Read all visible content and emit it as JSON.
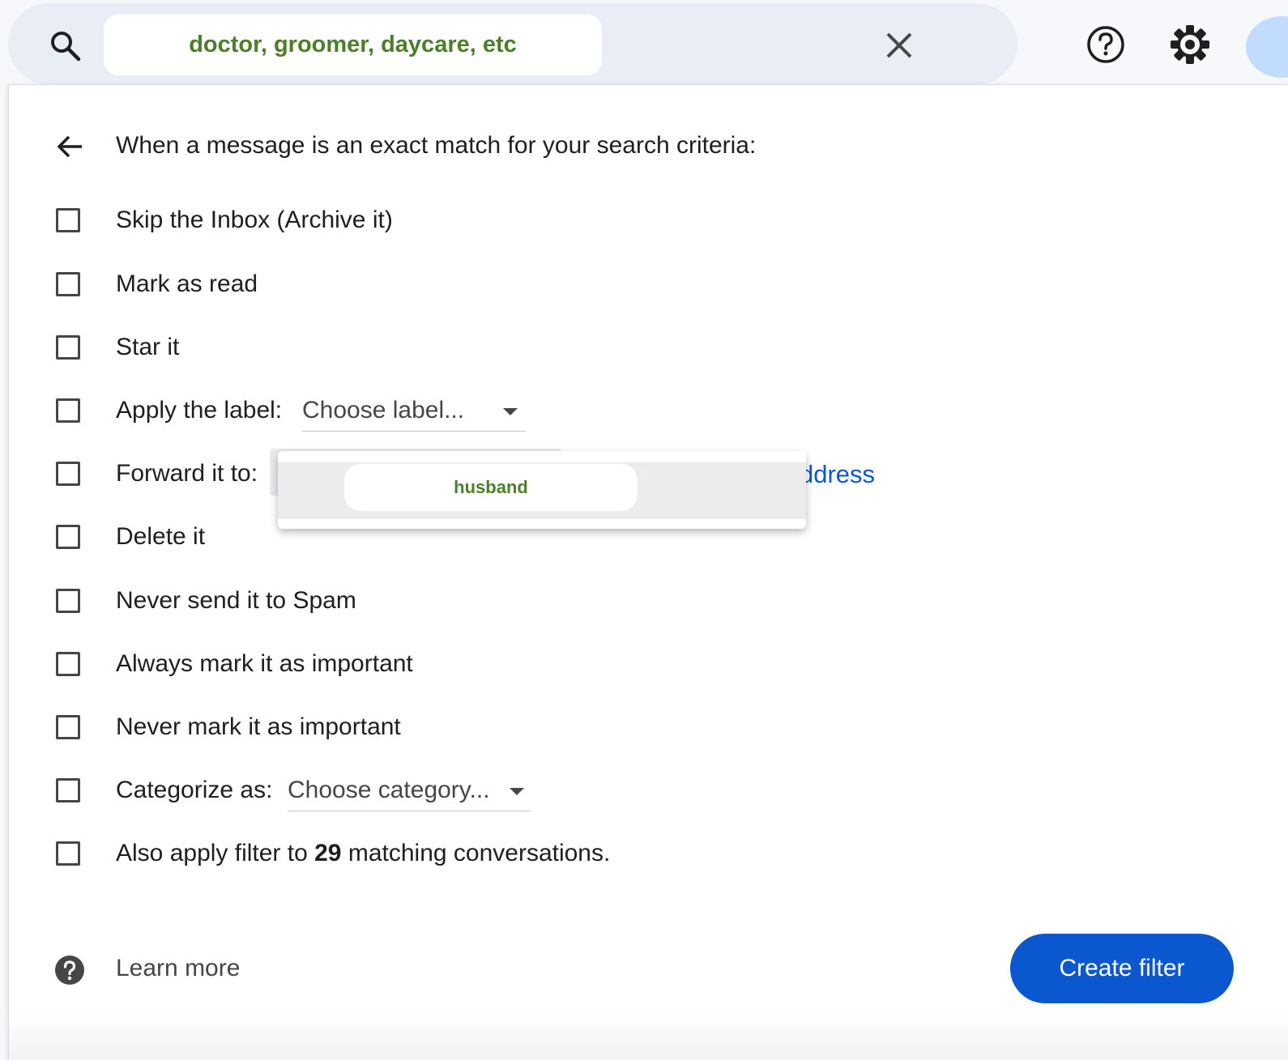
{
  "search": {
    "chip_text": "doctor, groomer, daycare, etc"
  },
  "icons": {
    "search": "search-icon",
    "close": "close-icon",
    "help": "help-icon",
    "settings": "gear-icon",
    "back": "arrow-back-icon",
    "learn_more": "help-circle-filled-icon"
  },
  "filter": {
    "heading": "When a message is an exact match for your search criteria:",
    "options": [
      {
        "label": "Skip the Inbox (Archive it)"
      },
      {
        "label": "Mark as read"
      },
      {
        "label": "Star it"
      },
      {
        "label": "Apply the label:"
      },
      {
        "label": "Forward it to:"
      },
      {
        "label": "Delete it"
      },
      {
        "label": "Never send it to Spam"
      },
      {
        "label": "Always mark it as important"
      },
      {
        "label": "Never mark it as important"
      },
      {
        "label": "Categorize as:"
      }
    ],
    "label_select": "Choose label...",
    "category_select": "Choose category...",
    "forward_link_visible": "ddress",
    "apply_prefix": "Also apply filter to ",
    "apply_count": "29",
    "apply_suffix": " matching conversations."
  },
  "popup": {
    "item": "husband"
  },
  "footer": {
    "learn_more": "Learn more",
    "create_filter": "Create filter"
  },
  "colors": {
    "accent": "#0b57d0",
    "chip_text": "#4b7f2a"
  }
}
